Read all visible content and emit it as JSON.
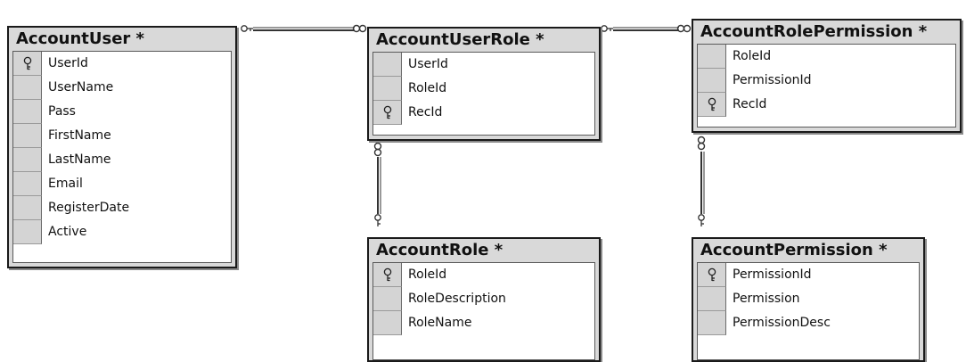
{
  "tables": {
    "account_user": {
      "title": "AccountUser *",
      "columns": [
        {
          "name": "UserId",
          "key": true
        },
        {
          "name": "UserName",
          "key": false
        },
        {
          "name": "Pass",
          "key": false
        },
        {
          "name": "FirstName",
          "key": false
        },
        {
          "name": "LastName",
          "key": false
        },
        {
          "name": "Email",
          "key": false
        },
        {
          "name": "RegisterDate",
          "key": false
        },
        {
          "name": "Active",
          "key": false
        }
      ]
    },
    "account_user_role": {
      "title": "AccountUserRole *",
      "columns": [
        {
          "name": "UserId",
          "key": false
        },
        {
          "name": "RoleId",
          "key": false
        },
        {
          "name": "RecId",
          "key": true
        }
      ]
    },
    "account_role_permission": {
      "title": "AccountRolePermission *",
      "columns": [
        {
          "name": "RoleId",
          "key": false
        },
        {
          "name": "PermissionId",
          "key": false
        },
        {
          "name": "RecId",
          "key": true
        }
      ]
    },
    "account_role": {
      "title": "AccountRole *",
      "columns": [
        {
          "name": "RoleId",
          "key": true
        },
        {
          "name": "RoleDescription",
          "key": false
        },
        {
          "name": "RoleName",
          "key": false
        }
      ]
    },
    "account_permission": {
      "title": "AccountPermission *",
      "columns": [
        {
          "name": "PermissionId",
          "key": true
        },
        {
          "name": "Permission",
          "key": false
        },
        {
          "name": "PermissionDesc",
          "key": false
        }
      ]
    }
  },
  "relationships": [
    {
      "from": "AccountUser",
      "to": "AccountUserRole",
      "from_end": "key-icon",
      "to_end": "infinity-icon"
    },
    {
      "from": "AccountUserRole",
      "to": "AccountRolePermission",
      "from_end": "key-icon",
      "to_end": "infinity-icon"
    },
    {
      "from": "AccountUserRole",
      "to": "AccountRole",
      "from_end": "infinity-icon",
      "to_end": "key-icon"
    },
    {
      "from": "AccountRolePermission",
      "to": "AccountPermission",
      "from_end": "infinity-icon",
      "to_end": "key-icon"
    }
  ],
  "colors": {
    "title_bar": "#d9d9d9",
    "border": "#1a1a1a",
    "selector": "#d4d4d4",
    "line": "#333333"
  }
}
